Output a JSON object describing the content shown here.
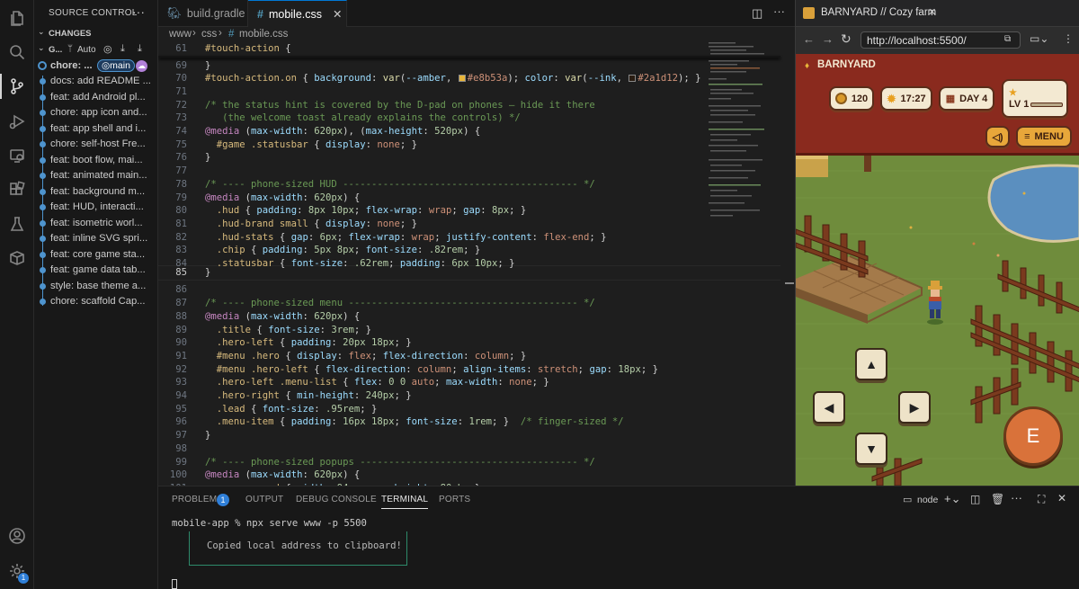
{
  "sidebar": {
    "title": "SOURCE CONTROL",
    "changes_label": "CHANGES",
    "graph_label": "G...",
    "auto_label": "Auto",
    "branch": "main",
    "commits": [
      "chore: ...",
      "docs: add README ...",
      "feat: add Android pl...",
      "chore: app icon and...",
      "feat: app shell and i...",
      "chore: self-host Fre...",
      "feat: boot flow, mai...",
      "feat: animated main...",
      "feat: background m...",
      "feat: HUD, interacti...",
      "feat: isometric worl...",
      "feat: inline SVG spri...",
      "feat: core game sta...",
      "feat: game data tab...",
      "style: base theme a...",
      "chore: scaffold Cap..."
    ]
  },
  "activity": {
    "settings_badge": "1"
  },
  "tabs": {
    "tab1": "build.gradle",
    "tab2": "mobile.css"
  },
  "breadcrumb": {
    "a": "www",
    "b": "css",
    "c": "mobile.css"
  },
  "editor": {
    "line_numbers": [
      "61",
      "69",
      "70",
      "71",
      "72",
      "73",
      "74",
      "75",
      "76",
      "77",
      "78",
      "79",
      "80",
      "81",
      "82",
      "83",
      "84",
      "85",
      "86",
      "87",
      "88",
      "89",
      "90",
      "91",
      "92",
      "93",
      "94",
      "95",
      "96",
      "97",
      "98",
      "99",
      "100",
      "101"
    ],
    "current_line": "85"
  },
  "browser": {
    "tab_title": "BARNYARD // Cozy farm",
    "url": "http://localhost:5500/",
    "brand": "BARNYARD",
    "coins": "120",
    "time": "17:27",
    "day": "DAY 4",
    "level": "LV 1",
    "menu": "MENU",
    "action": "E"
  },
  "panel": {
    "tabs": [
      "PROBLEMS",
      "OUTPUT",
      "DEBUG CONSOLE",
      "TERMINAL",
      "PORTS"
    ],
    "problems_count": "1",
    "shell": "node",
    "command": "mobile-app % npx serve www -p 5500",
    "toast": "Copied local address to clipboard!"
  },
  "colors": {
    "accent": "#0078d4",
    "git_graph": "#4e94ce",
    "hud_red": "#8a2a1e",
    "grass": "#6f8c3c"
  }
}
